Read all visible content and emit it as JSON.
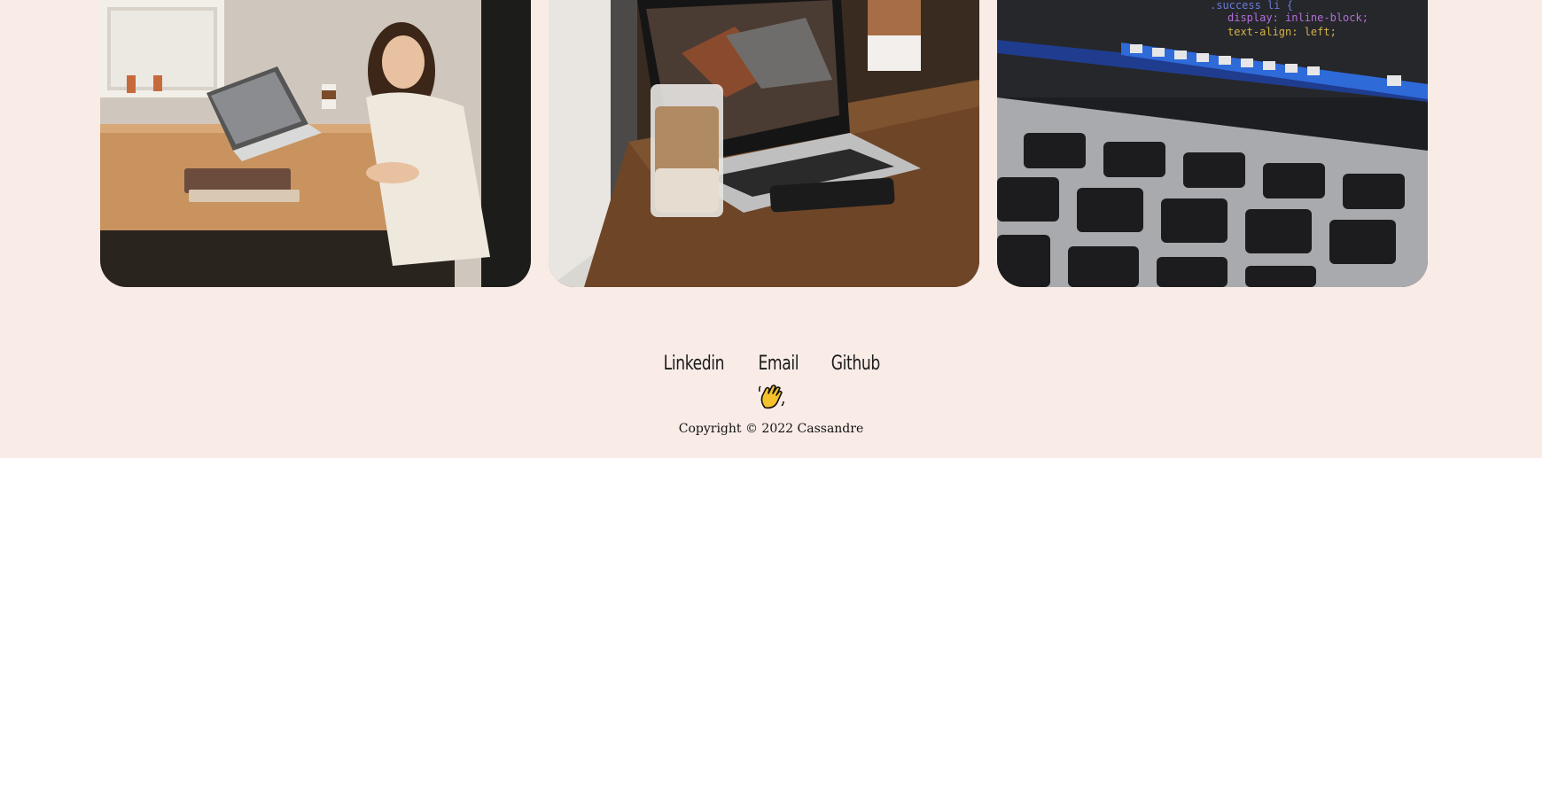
{
  "gallery": {
    "images": [
      {
        "alt": "woman-writing-at-desk-with-laptop"
      },
      {
        "alt": "iced-coffee-and-laptop-on-wooden-table"
      },
      {
        "alt": "laptop-keyboard-with-code-on-screen"
      }
    ]
  },
  "footer": {
    "links": [
      {
        "label": "Linkedin"
      },
      {
        "label": "Email"
      },
      {
        "label": "Github"
      }
    ],
    "emoji": "waving-hand-icon",
    "copyright": "Copyright © 2022 Cassandre"
  },
  "colors": {
    "background": "#f9ece7",
    "page": "#ffffff",
    "text": "#111111"
  }
}
